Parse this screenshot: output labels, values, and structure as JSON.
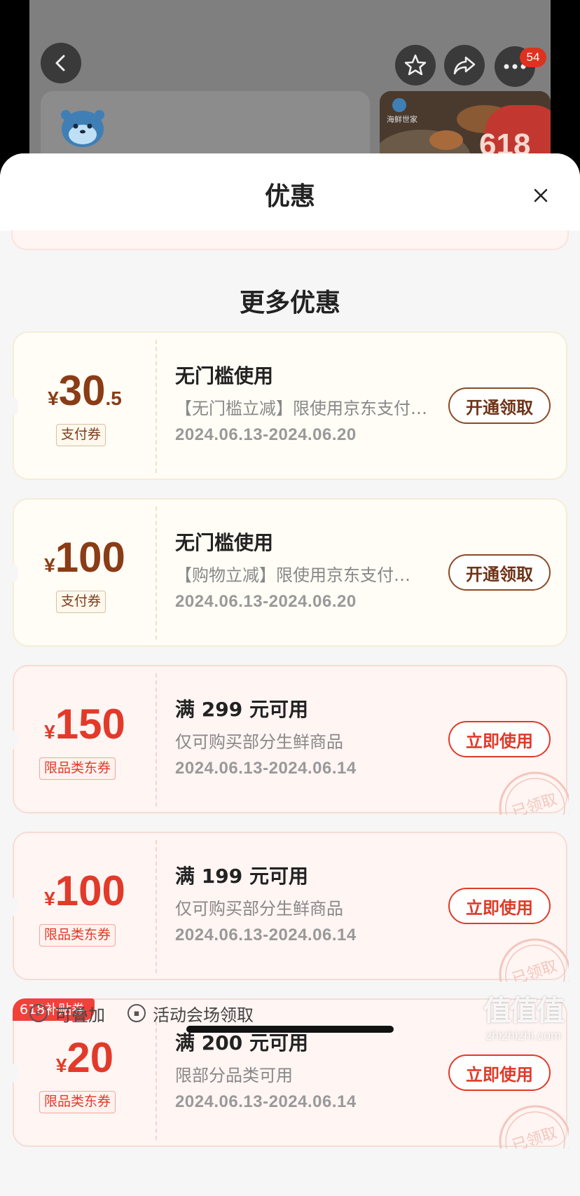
{
  "background": {
    "notification_count": "54",
    "promo_label": "618",
    "shop_label": "海鲜世家"
  },
  "sheet": {
    "title": "优惠",
    "section_title": "更多优惠"
  },
  "coupons": [
    {
      "currency": "¥",
      "amount_int": "30",
      "amount_dec": ".5",
      "type": "支付券",
      "title": "无门槛使用",
      "desc": "【无门槛立减】限使用京东支付…",
      "date": "2024.06.13-2024.06.20",
      "button": "开通领取",
      "style": "gold"
    },
    {
      "currency": "¥",
      "amount_int": "100",
      "amount_dec": "",
      "type": "支付券",
      "title": "无门槛使用",
      "desc": "【购物立减】限使用京东支付…",
      "date": "2024.06.13-2024.06.20",
      "button": "开通领取",
      "style": "gold"
    },
    {
      "currency": "¥",
      "amount_int": "150",
      "amount_dec": "",
      "type": "限品类东券",
      "title": "满 299 元可用",
      "desc": "仅可购买部分生鲜商品",
      "date": "2024.06.13-2024.06.14",
      "button": "立即使用",
      "stamp": "已领取",
      "style": "red"
    },
    {
      "currency": "¥",
      "amount_int": "100",
      "amount_dec": "",
      "type": "限品类东券",
      "title": "满 199 元可用",
      "desc": "仅可购买部分生鲜商品",
      "date": "2024.06.13-2024.06.14",
      "button": "立即使用",
      "stamp": "已领取",
      "style": "red"
    },
    {
      "currency": "¥",
      "amount_int": "20",
      "amount_dec": "",
      "type": "限品类东券",
      "title": "满 200 元可用",
      "desc": "限部分品类可用",
      "date": "2024.06.13-2024.06.14",
      "button": "立即使用",
      "stamp": "已领取",
      "badge": "618补贴券",
      "style": "red"
    }
  ],
  "footer": {
    "stackable": "可叠加",
    "venue": "活动会场领取"
  },
  "watermark": {
    "top": "值值值",
    "bottom": "zhizhizhi.com"
  }
}
